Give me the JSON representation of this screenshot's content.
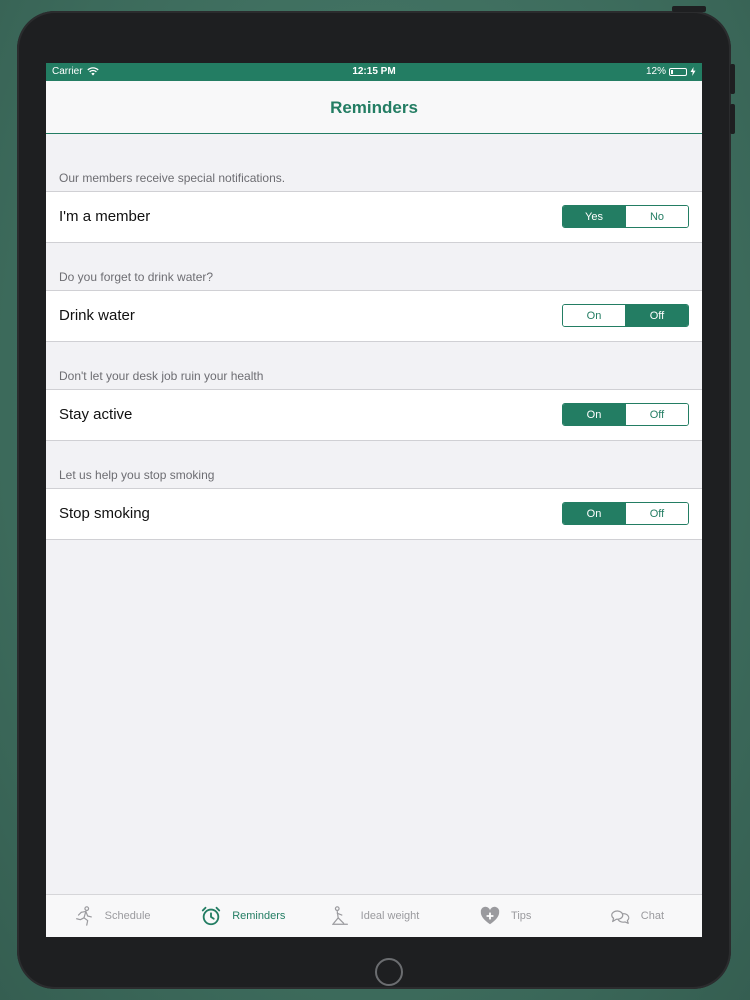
{
  "status_bar": {
    "carrier": "Carrier",
    "time": "12:15 PM",
    "battery_percent": "12%",
    "battery_level": 0.12
  },
  "nav": {
    "title": "Reminders"
  },
  "sections": [
    {
      "header": "Our members receive special notifications.",
      "label": "I'm a member",
      "options": [
        "Yes",
        "No"
      ],
      "selected_index": 0
    },
    {
      "header": "Do you forget to drink water?",
      "label": "Drink water",
      "options": [
        "On",
        "Off"
      ],
      "selected_index": 1
    },
    {
      "header": "Don't let your desk job ruin your health",
      "label": "Stay active",
      "options": [
        "On",
        "Off"
      ],
      "selected_index": 0
    },
    {
      "header": "Let us help you stop smoking",
      "label": "Stop smoking",
      "options": [
        "On",
        "Off"
      ],
      "selected_index": 0
    }
  ],
  "tabs": [
    {
      "label": "Schedule",
      "icon": "running-figure-icon",
      "active": false
    },
    {
      "label": "Reminders",
      "icon": "alarm-clock-icon",
      "active": true
    },
    {
      "label": "Ideal weight",
      "icon": "yoga-figure-icon",
      "active": false
    },
    {
      "label": "Tips",
      "icon": "heart-plus-icon",
      "active": false
    },
    {
      "label": "Chat",
      "icon": "chat-bubbles-icon",
      "active": false
    }
  ],
  "colors": {
    "accent": "#237d63",
    "background": "#f2f2f5",
    "inactive_tab": "#9a9a9e"
  }
}
